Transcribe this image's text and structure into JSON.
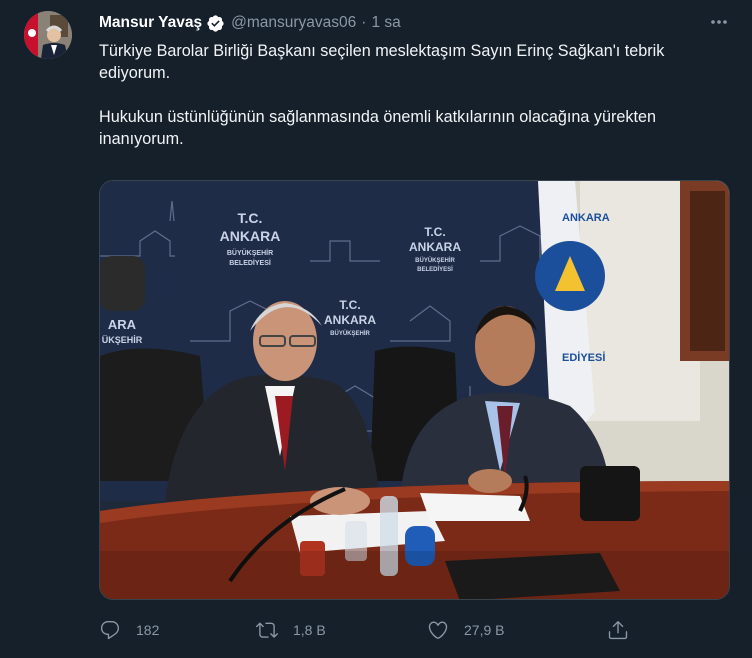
{
  "author": {
    "name": "Mansur Yavaş",
    "handle": "@mansuryavas06",
    "time": "1 sa",
    "separator": "·"
  },
  "tweet": {
    "paragraph1": "Türkiye Barolar Birliği Başkanı seçilen meslektaşım Sayın Erinç Sağkan'ı tebrik ediyorum.",
    "paragraph2": "Hukukun üstünlüğünün sağlanmasında önemli katkılarının olacağına yürekten inanıyorum."
  },
  "photo": {
    "banner_line1": "T.C.",
    "banner_line2": "ANKARA",
    "banner_line3": "BÜYÜKŞEHİR",
    "banner_line4": "BELEDİYESİ",
    "banner_left_line1": "ARA",
    "banner_left_line2": "ÜKŞEHİR",
    "flag_top": "ANKARA",
    "flag_bottom": "EDİYESİ"
  },
  "actions": {
    "replies": "182",
    "retweets": "1,8 B",
    "likes": "27,9 B"
  },
  "icons": {
    "verified": "verified-badge-icon",
    "more": "more-options-icon",
    "reply": "reply-icon",
    "retweet": "retweet-icon",
    "like": "like-icon",
    "share": "share-icon"
  },
  "colors": {
    "background": "#15202b",
    "verified": "#ffffff",
    "secondary_text": "#8b98a5"
  }
}
